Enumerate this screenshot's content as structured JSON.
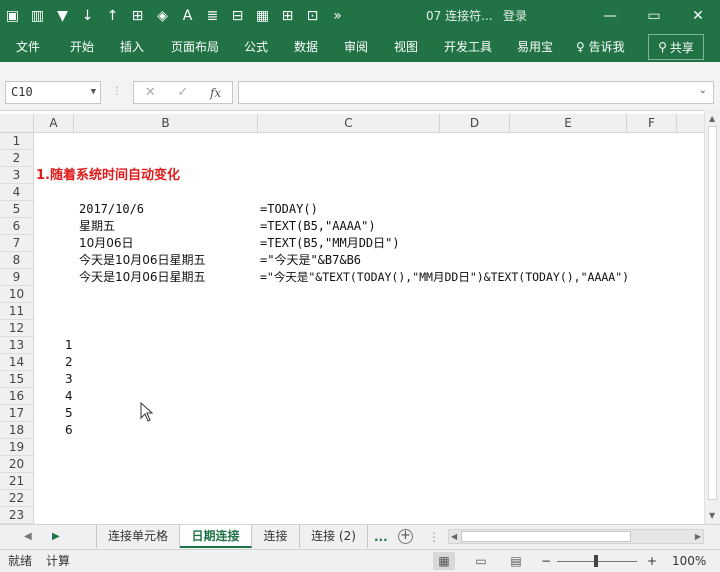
{
  "titlebar": {
    "doc_title": "07 连接符...",
    "login": "登录",
    "qat_icons": [
      "save-icon",
      "format-painter-icon",
      "filter-icon",
      "sort-asc-icon",
      "sort-desc-icon",
      "borders-icon",
      "fill-color-icon",
      "font-color-icon",
      "wrap-text-icon",
      "merge-icon",
      "select-icon",
      "grid-icon",
      "freeze-icon",
      "more-icon"
    ],
    "qat_glyphs": [
      "▣",
      "▥",
      "▼",
      "↓",
      "↑",
      "⊞",
      "◈",
      "A",
      "≣",
      "⊟",
      "▦",
      "⊞",
      "⊡",
      "»"
    ],
    "minimize": "—",
    "restore": "▭",
    "close": "✕"
  },
  "menu": {
    "items": [
      "文件",
      "开始",
      "插入",
      "页面布局",
      "公式",
      "数据",
      "审阅",
      "视图",
      "开发工具",
      "易用宝"
    ],
    "tell_me": "告诉我",
    "share": "共享"
  },
  "formula_bar": {
    "name_box": "C10",
    "cancel": "✕",
    "enter": "✓",
    "fx": "fx",
    "formula": ""
  },
  "columns": [
    "A",
    "B",
    "C",
    "D",
    "E",
    "F"
  ],
  "rows": [
    "1",
    "2",
    "3",
    "4",
    "5",
    "6",
    "7",
    "8",
    "9",
    "10",
    "11",
    "12",
    "13",
    "14",
    "15",
    "16",
    "17",
    "18",
    "19",
    "20",
    "21",
    "22",
    "23"
  ],
  "cells": {
    "A3": "1.随着系统时间自动变化",
    "B5": "2017/10/6",
    "C5": "=TODAY()",
    "B6": "星期五",
    "C6": "=TEXT(B5,\"AAAA\")",
    "B7": "10月06日",
    "C7": "=TEXT(B5,\"MM月DD日\")",
    "B8": "今天是10月06日星期五",
    "C8": "=\"今天是\"&B7&B6",
    "B9": "今天是10月06日星期五",
    "C9": "=\"今天是\"&TEXT(TODAY(),\"MM月DD日\")&TEXT(TODAY(),\"AAAA\")",
    "B13": "1",
    "B14": "2",
    "B15": "3",
    "B16": "4",
    "B17": "5",
    "B18": "6"
  },
  "sheets": {
    "tabs": [
      "连接单元格",
      "日期连接",
      "连接",
      "连接 (2)"
    ],
    "active": "日期连接",
    "more": "...",
    "add": "+"
  },
  "status": {
    "ready": "就绪",
    "calculate": "计算",
    "zoom_minus": "−",
    "zoom_plus": "+",
    "zoom": "100%"
  },
  "colors": {
    "brand": "#217346",
    "highlight": "#e01b1b"
  }
}
